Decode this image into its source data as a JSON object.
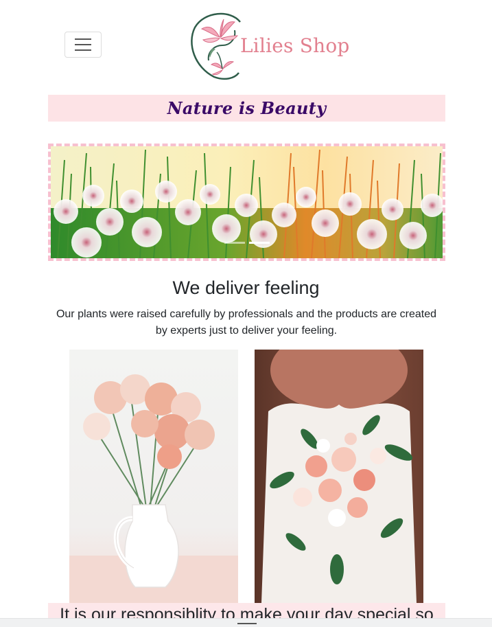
{
  "navbar": {
    "toggler_icon": "hamburger-menu-icon",
    "brand": "Lilies Shop",
    "logo_icon": "lily-flower-logo-icon"
  },
  "tagline": "Nature is Beauty",
  "carousel": {
    "slide_image": "dandelion-meadow-sunset-photo",
    "slide_count": 2,
    "active_slide": 2
  },
  "intro": {
    "heading": "We deliver feeling",
    "text": "Our plants were raised carefully by professionals and the products are created by experts just to deliver your feeling."
  },
  "gallery": [
    {
      "image": "carnations-in-white-jug-photo"
    },
    {
      "image": "bride-holding-bouquet-photo"
    }
  ],
  "banner": {
    "text": "It is our responsiblity to make your day special so"
  },
  "colors": {
    "tagline_background": "#fde3e6",
    "tagline_text": "#3a0a67",
    "brand_pink": "#e2808f",
    "carousel_border": "#f7c0cf"
  }
}
